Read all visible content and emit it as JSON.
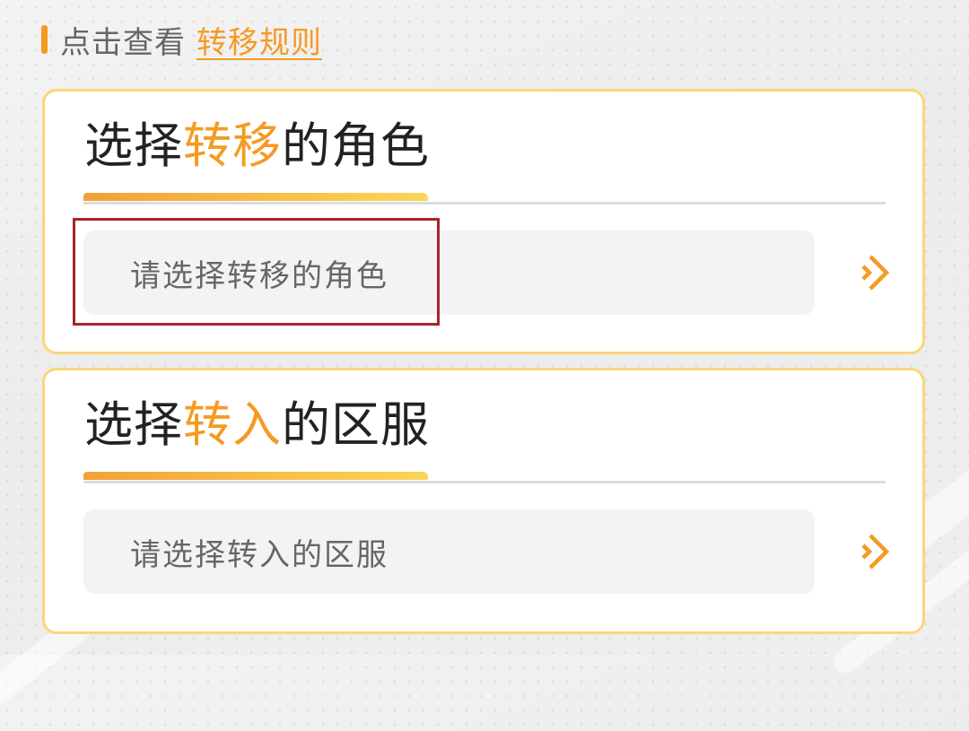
{
  "header": {
    "prefix": "点击查看",
    "rule_link": "转移规则"
  },
  "role_card": {
    "title_prefix": "选择",
    "title_highlight": "转移",
    "title_suffix": "的角色",
    "placeholder": "请选择转移的角色",
    "chevron_icon": "chevron-right-icon"
  },
  "server_card": {
    "title_prefix": "选择",
    "title_highlight": "转入",
    "title_suffix": "的区服",
    "placeholder": "请选择转入的区服",
    "chevron_icon": "chevron-right-icon"
  },
  "colors": {
    "accent": "#f59a23",
    "card_border": "#fbd57a",
    "field_bg": "#f3f3f3",
    "highlight": "#a8242c"
  }
}
